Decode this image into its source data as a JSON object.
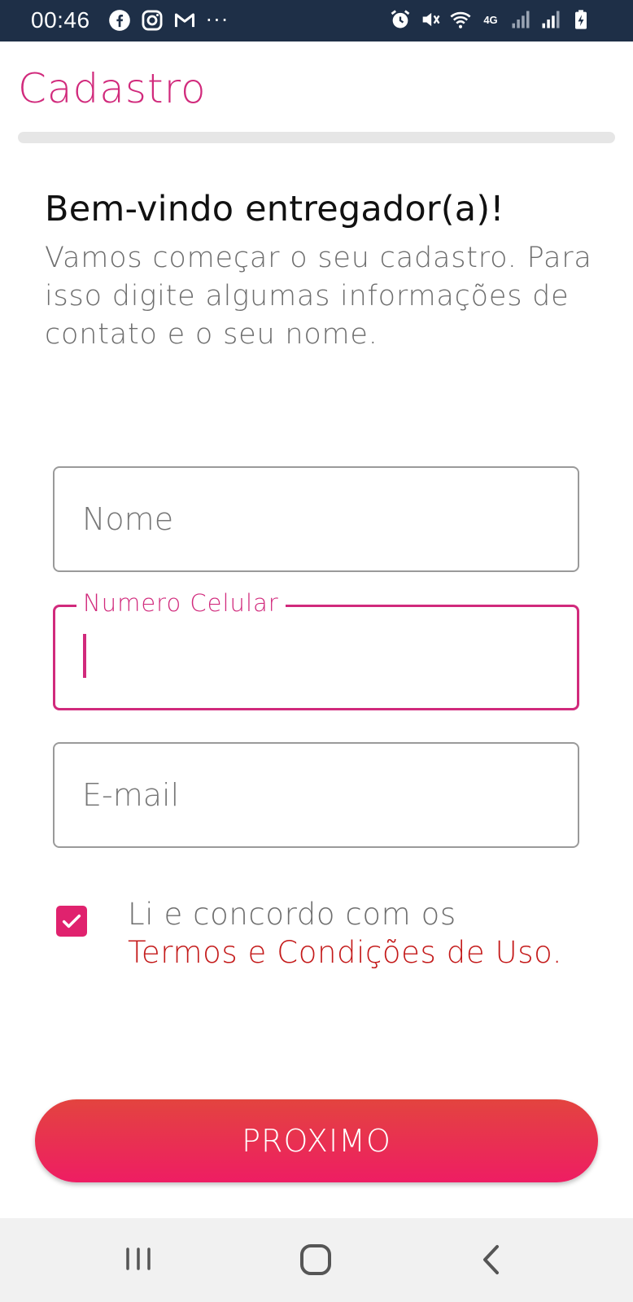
{
  "status_bar": {
    "time": "00:46",
    "left_icons": [
      "facebook-icon",
      "instagram-icon",
      "gmail-icon"
    ],
    "more": "···",
    "network_tag": "4G",
    "right_icons": [
      "alarm-icon",
      "vibrate-mute-icon",
      "wifi-icon",
      "network-4g-icon",
      "signal-icon",
      "signal-icon",
      "battery-charging-icon"
    ]
  },
  "header": {
    "title": "Cadastro",
    "progress": 0
  },
  "welcome": {
    "title": "Bem-vindo entregador(a)!",
    "text": "Vamos começar o seu cadastro. Para isso digite algumas informações de contato e o seu nome."
  },
  "form": {
    "name": {
      "placeholder": "Nome",
      "value": ""
    },
    "phone": {
      "label": "Numero Celular",
      "value": ""
    },
    "email": {
      "placeholder": "E-mail",
      "value": ""
    }
  },
  "terms": {
    "checked": true,
    "prefix": "Li e concordo com os",
    "link": "Termos e Condições de Uso",
    "suffix": "."
  },
  "next_button": {
    "label": "PROXIMO"
  },
  "colors": {
    "accent": "#d12a7c",
    "status_bar": "#1e2f47",
    "button_top": "#e3443f",
    "button_bottom": "#ee1d63",
    "link": "#c41a1a"
  },
  "nav_bar": {
    "icons": [
      "recent-apps-icon",
      "home-icon",
      "back-icon"
    ]
  }
}
